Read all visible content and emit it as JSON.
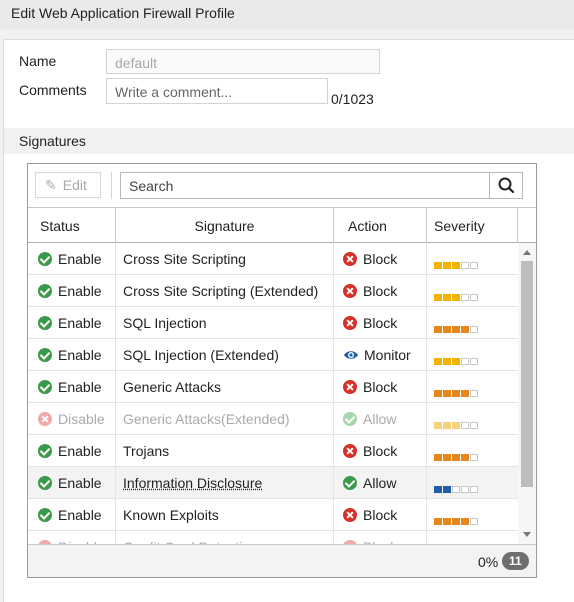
{
  "window": {
    "title": "Edit Web Application Firewall Profile"
  },
  "form": {
    "name_label": "Name",
    "name_value": "default",
    "comments_label": "Comments",
    "comments_placeholder": "Write a comment...",
    "comments_counter": "0/1023"
  },
  "signatures": {
    "section_title": "Signatures",
    "toolbar": {
      "edit_label": "Edit",
      "search_placeholder": "Search"
    },
    "columns": [
      "Status",
      "Signature",
      "Action",
      "Severity"
    ],
    "rows": [
      {
        "status": "Enable",
        "signature": "Cross Site Scripting",
        "action": "Block",
        "severity_level": 3,
        "severity_color": "#f0b400",
        "dim": false,
        "highlight": false,
        "link": false
      },
      {
        "status": "Enable",
        "signature": "Cross Site Scripting (Extended)",
        "action": "Block",
        "severity_level": 3,
        "severity_color": "#f0b400",
        "dim": false,
        "highlight": false,
        "link": false
      },
      {
        "status": "Enable",
        "signature": "SQL Injection",
        "action": "Block",
        "severity_level": 4,
        "severity_color": "#e8861a",
        "dim": false,
        "highlight": false,
        "link": false
      },
      {
        "status": "Enable",
        "signature": "SQL Injection (Extended)",
        "action": "Monitor",
        "severity_level": 3,
        "severity_color": "#f0b400",
        "dim": false,
        "highlight": false,
        "link": false
      },
      {
        "status": "Enable",
        "signature": "Generic Attacks",
        "action": "Block",
        "severity_level": 4,
        "severity_color": "#e8861a",
        "dim": false,
        "highlight": false,
        "link": false
      },
      {
        "status": "Disable",
        "signature": "Generic Attacks(Extended)",
        "action": "Allow",
        "severity_level": 3,
        "severity_color": "#f6d37a",
        "dim": true,
        "highlight": false,
        "link": false
      },
      {
        "status": "Enable",
        "signature": "Trojans",
        "action": "Block",
        "severity_level": 4,
        "severity_color": "#e8861a",
        "dim": false,
        "highlight": false,
        "link": false
      },
      {
        "status": "Enable",
        "signature": "Information Disclosure",
        "action": "Allow",
        "severity_level": 2,
        "severity_color": "#1f5fa8",
        "dim": false,
        "highlight": true,
        "link": true
      },
      {
        "status": "Enable",
        "signature": "Known Exploits",
        "action": "Block",
        "severity_level": 4,
        "severity_color": "#e8861a",
        "dim": false,
        "highlight": false,
        "link": false
      },
      {
        "status": "Disable",
        "signature": "Credit Card Detection",
        "action": "Block",
        "severity_level": 0,
        "severity_color": "#f0b400",
        "dim": true,
        "highlight": false,
        "link": false
      }
    ],
    "footer": {
      "percent": "0%",
      "count": "11"
    }
  }
}
